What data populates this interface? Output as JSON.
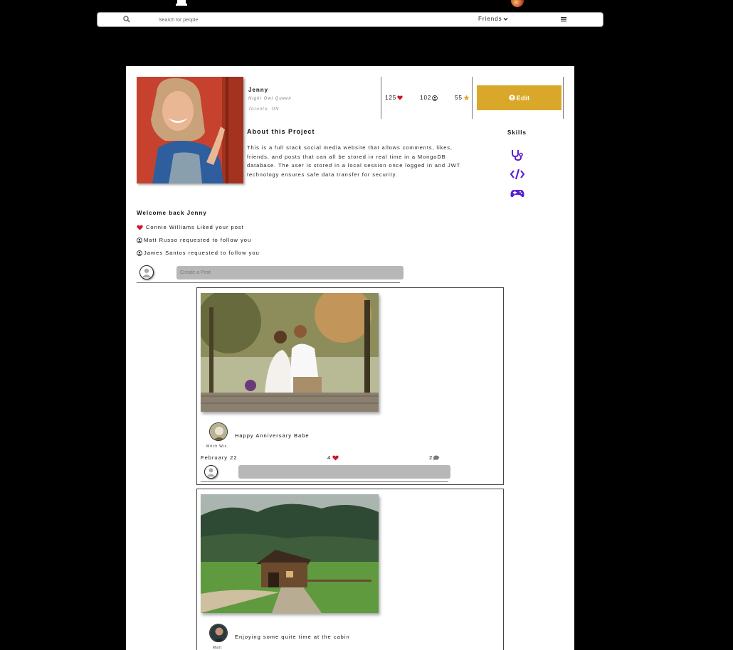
{
  "colors": {
    "accent": "#d9a82a",
    "heart": "#d0142a",
    "star": "#d9a82a",
    "skill": "#5a1fd6",
    "input_bg": "#b7b7b7"
  },
  "topbar": {
    "logo_icon": "user-shirt-icon",
    "search_placeholder": "Search for people",
    "filter_label": "Friends",
    "menu_icon": "hamburger-icon"
  },
  "profile": {
    "name": "Jenny",
    "tagline": "Night Owl Queen",
    "location": "Toronto, ON",
    "likes": "125",
    "followers": "102",
    "stars": "55",
    "edit_label": "Edit"
  },
  "about": {
    "title": "About this Project",
    "text": "This is a full stack social media website that allows comments, likes, friends, and posts that can all be stored in real time in a MongoDB database. The user is stored in a local session once logged in and JWT technology ensures safe data transfer for security."
  },
  "skills": {
    "title": "Skills",
    "items": [
      "stethoscope-icon",
      "code-icon",
      "gamepad-icon"
    ]
  },
  "feed": {
    "welcome": "Welcome back Jenny",
    "notifications": [
      {
        "icon": "heart-icon",
        "text": "Connie Williams Liked your post"
      },
      {
        "icon": "user-circle-icon",
        "text": "Matt Russo requested to follow you"
      },
      {
        "icon": "user-circle-icon",
        "text": "James Santos requested to follow you"
      }
    ],
    "create_placeholder": "Create a Post"
  },
  "posts": [
    {
      "author": "Mitch Wis",
      "caption": "Happy Anniversary Babe",
      "date": "February 22",
      "likes": "4",
      "comments": "2"
    },
    {
      "author": "Matt",
      "caption": "Enjoying some quite time at the cabin"
    }
  ]
}
